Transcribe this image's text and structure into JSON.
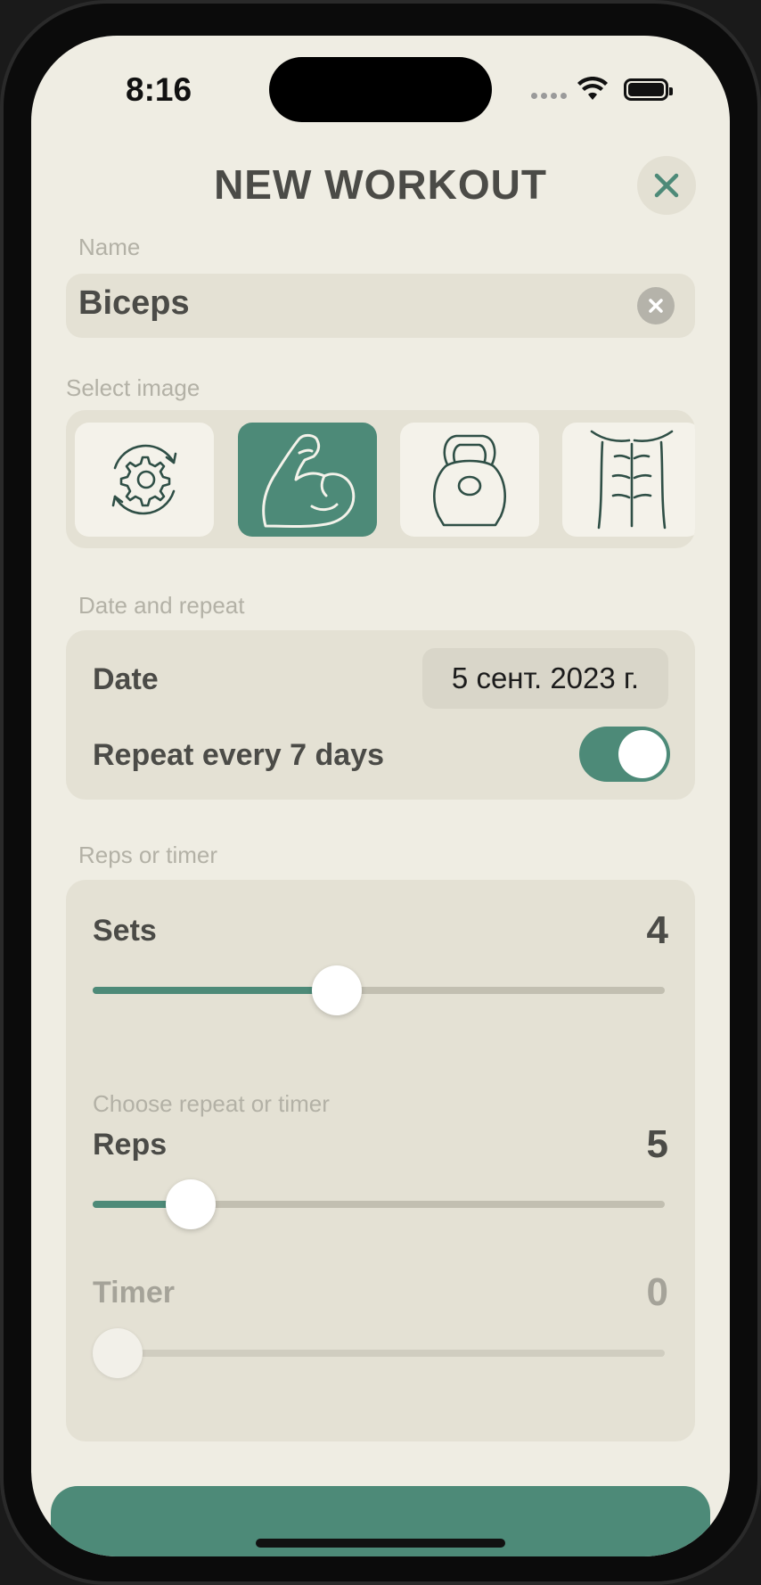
{
  "status_bar": {
    "time": "8:16"
  },
  "header": {
    "title": "NEW WORKOUT"
  },
  "name_section": {
    "label": "Name",
    "value": "Biceps"
  },
  "image_section": {
    "label": "Select image",
    "images": [
      {
        "icon": "gear-refresh-icon",
        "selected": false
      },
      {
        "icon": "flexed-biceps-icon",
        "selected": true
      },
      {
        "icon": "kettlebell-icon",
        "selected": false
      },
      {
        "icon": "abs-torso-icon",
        "selected": false
      }
    ]
  },
  "date_section": {
    "label": "Date and repeat",
    "date_label": "Date",
    "date_value": "5 сент. 2023 г.",
    "repeat_label": "Repeat every 7 days",
    "repeat_enabled": true
  },
  "reps_section": {
    "label": "Reps or timer",
    "sets_label": "Sets",
    "sets_value": "4",
    "sets_fraction": 0.42,
    "choose_label": "Choose repeat or timer",
    "reps_label": "Reps",
    "reps_value": "5",
    "reps_fraction": 0.14,
    "timer_label": "Timer",
    "timer_value": "0",
    "timer_fraction": 0.0
  },
  "colors": {
    "accent": "#4d8a78",
    "background": "#efede3",
    "card": "#e4e1d4",
    "text": "#4b4b47"
  }
}
